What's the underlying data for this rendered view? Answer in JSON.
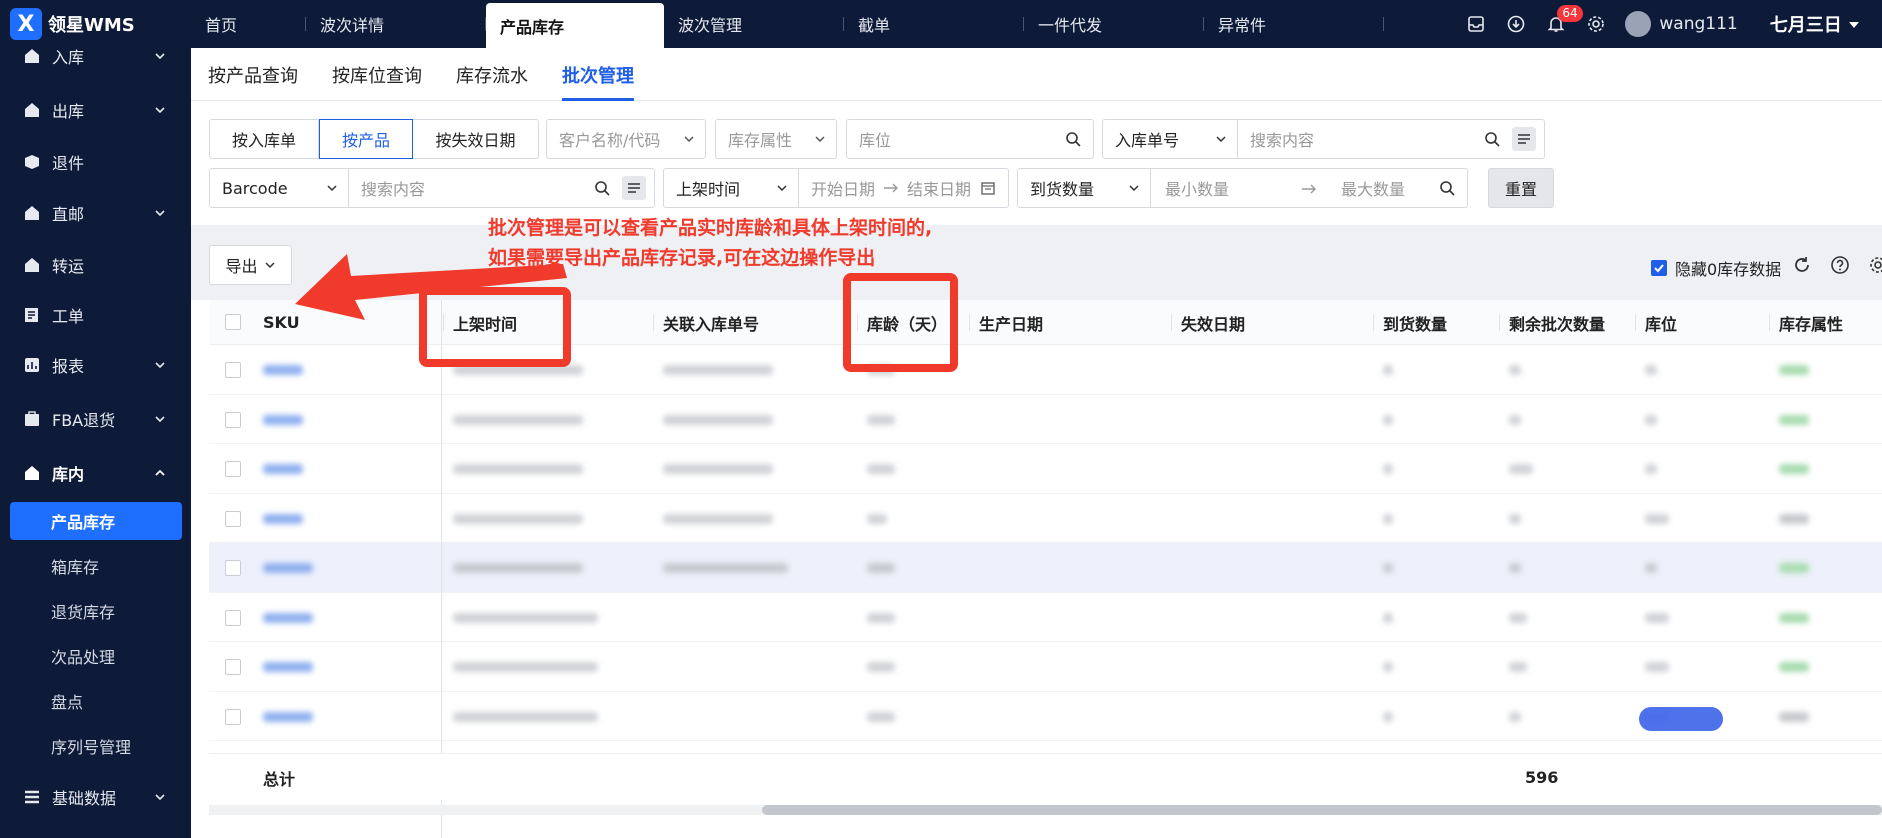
{
  "brand": {
    "logo_letter": "X",
    "name": "领星WMS"
  },
  "nav_tabs": [
    {
      "label": "首页"
    },
    {
      "label": "波次详情"
    },
    {
      "label": "产品库存",
      "active": true
    },
    {
      "label": "波次管理"
    },
    {
      "label": "截单"
    },
    {
      "label": "一件代发"
    },
    {
      "label": "异常件"
    }
  ],
  "header": {
    "notification_count": "64",
    "username": "wang111",
    "date_label": "七月三日"
  },
  "sidebar": {
    "items": [
      {
        "label": "入库",
        "icon": "home-icon"
      },
      {
        "label": "出库",
        "icon": "home-icon"
      },
      {
        "label": "退件",
        "icon": "box-icon"
      },
      {
        "label": "直邮",
        "icon": "home-icon"
      },
      {
        "label": "转运",
        "icon": "home-icon"
      },
      {
        "label": "工单",
        "icon": "edit-icon"
      },
      {
        "label": "报表",
        "icon": "chart-icon"
      },
      {
        "label": "FBA退货",
        "icon": "bag-icon"
      },
      {
        "label": "库内",
        "icon": "home-icon"
      },
      {
        "label": "基础数据",
        "icon": "list-icon"
      }
    ],
    "sub_items": [
      {
        "label": "产品库存",
        "active": true
      },
      {
        "label": "箱库存"
      },
      {
        "label": "退货库存"
      },
      {
        "label": "次品处理"
      },
      {
        "label": "盘点"
      },
      {
        "label": "序列号管理"
      }
    ]
  },
  "sub_tabs": [
    {
      "label": "按产品查询"
    },
    {
      "label": "按库位查询"
    },
    {
      "label": "库存流水"
    },
    {
      "label": "批次管理",
      "active": true
    }
  ],
  "filters": {
    "segmented": [
      {
        "label": "按入库单"
      },
      {
        "label": "按产品",
        "active": true
      },
      {
        "label": "按失效日期"
      }
    ],
    "customer_placeholder": "客户名称/代码",
    "stock_attr_placeholder": "库存属性",
    "location_placeholder": "库位",
    "inbound_select": "入库单号",
    "search_placeholder": "搜索内容",
    "barcode_select": "Barcode",
    "barcode_search_placeholder": "搜索内容",
    "time_select": "上架时间",
    "start_date_placeholder": "开始日期",
    "end_date_placeholder": "结束日期",
    "qty_select": "到货数量",
    "min_qty_placeholder": "最小数量",
    "max_qty_placeholder": "最大数量",
    "reset_label": "重置"
  },
  "toolbar": {
    "export_label": "导出",
    "hide_zero_label": "隐藏0库存数据"
  },
  "annotation": {
    "line1": "批次管理是可以查看产品实时库龄和具体上架时间的,",
    "line2": "如果需要导出产品库存记录,可在这边操作导出"
  },
  "table": {
    "columns": [
      "SKU",
      "上架时间",
      "关联入库单号",
      "库龄（天）",
      "生产日期",
      "失效日期",
      "到货数量",
      "剩余批次数量",
      "库位",
      "库存属性"
    ],
    "total_label": "总计",
    "total_remaining": "596"
  },
  "colors": {
    "primary": "#1f5fe8",
    "nav_bg": "#0d1a38",
    "annotation": "#f03a2c",
    "badge": "#f5373c"
  }
}
